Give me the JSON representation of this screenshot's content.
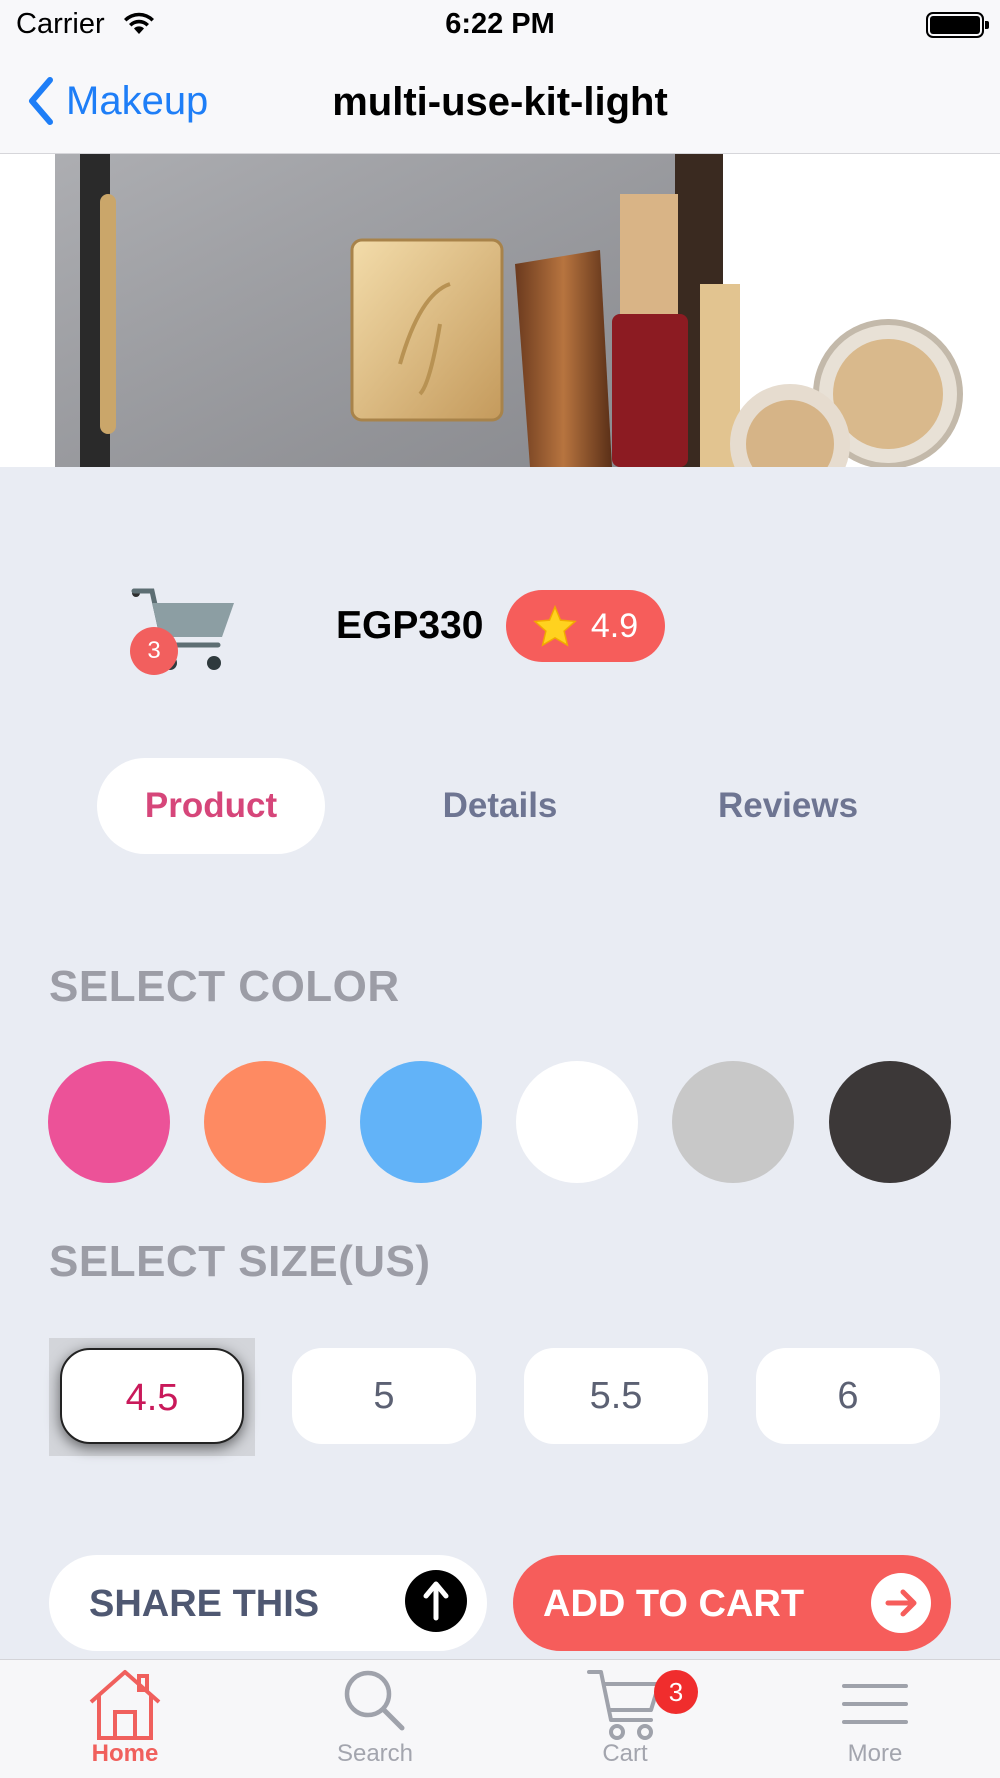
{
  "status_bar": {
    "carrier": "Carrier",
    "time": "6:22 PM"
  },
  "nav": {
    "back_label": "Makeup",
    "title": "multi-use-kit-light"
  },
  "product": {
    "cart_count": "3",
    "price": "EGP330",
    "rating": "4.9"
  },
  "tabs": [
    {
      "label": "Product",
      "active": true
    },
    {
      "label": "Details",
      "active": false
    },
    {
      "label": "Reviews",
      "active": false
    }
  ],
  "colors": {
    "title": "SELECT COLOR",
    "swatches": [
      "#ec5298",
      "#fe8a62",
      "#62b3f8",
      "#ffffff",
      "#c8c8c8",
      "#3c3838"
    ]
  },
  "sizes": {
    "title": "SELECT SIZE(US)",
    "options": [
      "4.5",
      "5",
      "5.5",
      "6"
    ],
    "selected": "4.5"
  },
  "actions": {
    "share_label": "SHARE THIS",
    "add_to_cart_label": "ADD TO CART"
  },
  "tab_bar": {
    "items": [
      {
        "label": "Home",
        "icon": "home-icon",
        "active": true
      },
      {
        "label": "Search",
        "icon": "search-icon",
        "active": false
      },
      {
        "label": "Cart",
        "icon": "cart-icon",
        "active": false
      },
      {
        "label": "More",
        "icon": "menu-icon",
        "active": false
      }
    ],
    "cart_badge": "3"
  },
  "accent_color": "#f65d5b"
}
